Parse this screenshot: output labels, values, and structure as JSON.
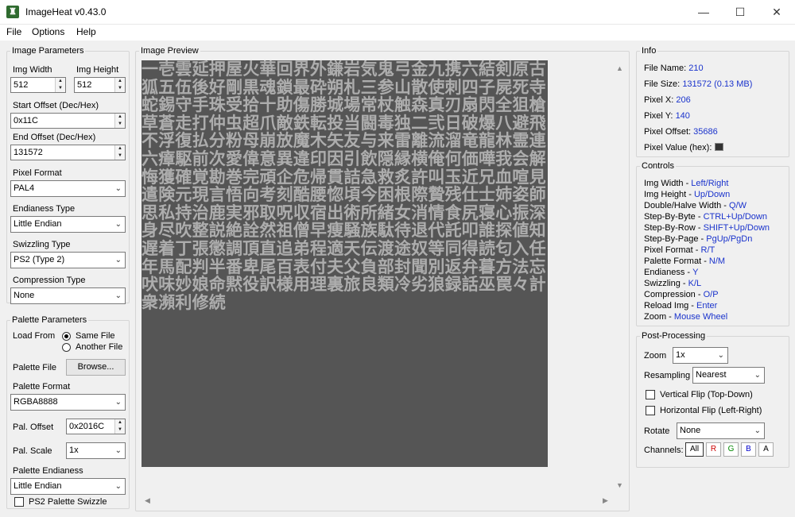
{
  "window": {
    "title": "ImageHeat v0.43.0",
    "icon": "app-icon",
    "minimize": "—",
    "maximize": "☐",
    "close": "✕"
  },
  "menu": [
    "File",
    "Options",
    "Help"
  ],
  "image_params": {
    "legend": "Image Parameters",
    "width_label": "Img Width",
    "width_value": "512",
    "height_label": "Img Height",
    "height_value": "512",
    "start_label": "Start Offset (Dec/Hex)",
    "start_value": "0x11C",
    "end_label": "End Offset (Dec/Hex)",
    "end_value": "131572",
    "pixel_format_label": "Pixel Format",
    "pixel_format_value": "PAL4",
    "endianess_label": "Endianess Type",
    "endianess_value": "Little Endian",
    "swizzling_label": "Swizzling Type",
    "swizzling_value": "PS2 (Type 2)",
    "compression_label": "Compression Type",
    "compression_value": "None"
  },
  "palette_params": {
    "legend": "Palette Parameters",
    "load_from_label": "Load From",
    "same_file": "Same File",
    "another_file": "Another File",
    "selected": "same_file",
    "file_label": "Palette File",
    "browse": "Browse...",
    "format_label": "Palette Format",
    "format_value": "RGBA8888",
    "offset_label": "Pal. Offset",
    "offset_value": "0x2016C",
    "scale_label": "Pal. Scale",
    "scale_value": "1x",
    "endianess_label": "Palette Endianess",
    "endianess_value": "Little Endian",
    "ps2_swizzle_label": "PS2 Palette Swizzle",
    "ps2_swizzle_checked": false
  },
  "preview": {
    "legend": "Image Preview",
    "glyphs": "一壱雲延押屋火華回界外鎌岩気鬼弓金九携六結剣原古狐五伍後好剛黒魂鎖最砕朔札三参山散使刺四子屍死寺蛇錫守手珠受拾十助傷勝城場常杖触森真刃扇閃全狙槍草蒼走打仲虫超爪敵鉄転投当闘毒独二弐日破爆八避飛不浮復払分粉母崩放魔木矢友与来雷離流溜竜龍林霊連六瘴駆前次愛偉意異違印因引飲隠縁横俺何価嘩我会解悔獲確覚勘巻完頑企危帰貫詰急救炙許叫玉近兄血喧見遣険元現言悟向考刻酷腰惚頃今困根際贄残仕士姉姿師思私持治鹿実邪取呪収宿出術所緒女消情食尻寝心振深身尽吹整説絶詮然祖僧早痩騒族駄待退代託叩誰探値知遅着丁張懲調頂直追弟程適天伝渡途奴等同得読匂入任年馬配判半番卑尾百表付夫父負部封聞別返弁暮方法忘吠味妙娘命黙役訳様用理裏旅良類冷劣狼録話巫罠々計衆瀕利修続"
  },
  "info": {
    "legend": "Info",
    "file_name_label": "File Name:",
    "file_name": "210",
    "file_size_label": "File Size:",
    "file_size": "131572 (0.13 MB)",
    "pixel_x_label": "Pixel X:",
    "pixel_x": "206",
    "pixel_y_label": "Pixel Y:",
    "pixel_y": "140",
    "pixel_offset_label": "Pixel Offset:",
    "pixel_offset": "35686",
    "pixel_value_label": "Pixel Value (hex):",
    "pixel_value_color": "#333333"
  },
  "controls": {
    "legend": "Controls",
    "rows": [
      {
        "label": "Img Width - ",
        "keys": "Left/Right"
      },
      {
        "label": "Img Height - ",
        "keys": "Up/Down"
      },
      {
        "label": "Double/Halve Width - ",
        "keys": "Q/W"
      },
      {
        "label": "Step-By-Byte - ",
        "keys": "CTRL+Up/Down"
      },
      {
        "label": "Step-By-Row - ",
        "keys": "SHIFT+Up/Down"
      },
      {
        "label": "Step-By-Page - ",
        "keys": "PgUp/PgDn"
      },
      {
        "label": "Pixel Format - ",
        "keys": "R/T"
      },
      {
        "label": "Palette Format - ",
        "keys": "N/M"
      },
      {
        "label": "Endianess - ",
        "keys": "Y"
      },
      {
        "label": "Swizzling - ",
        "keys": "K/L"
      },
      {
        "label": "Compression - ",
        "keys": "O/P"
      },
      {
        "label": "Reload Img - ",
        "keys": "Enter"
      },
      {
        "label": "Zoom - ",
        "keys": "Mouse Wheel"
      }
    ]
  },
  "post": {
    "legend": "Post-Processing",
    "zoom_label": "Zoom",
    "zoom_value": "1x",
    "resampling_label": "Resampling",
    "resampling_value": "Nearest",
    "vflip_label": "Vertical Flip (Top-Down)",
    "hflip_label": "Horizontal Flip (Left-Right)",
    "rotate_label": "Rotate",
    "rotate_value": "None",
    "channels_label": "Channels:",
    "channels": [
      "All",
      "R",
      "G",
      "B",
      "A"
    ],
    "channel_colors": [
      "#000000",
      "#cc0000",
      "#008800",
      "#0000cc",
      "#000000"
    ]
  }
}
